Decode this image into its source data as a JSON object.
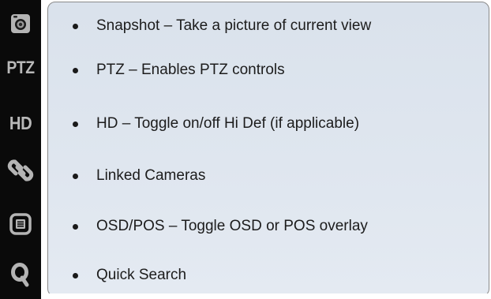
{
  "toolbar": {
    "ptz_label": "PTZ",
    "hd_label": "HD"
  },
  "items": [
    {
      "label": "Snapshot – Take a picture of current view",
      "icon": "camera-icon"
    },
    {
      "label": "PTZ – Enables PTZ controls",
      "icon": "ptz-icon"
    },
    {
      "label": "HD – Toggle on/off Hi Def (if applicable)",
      "icon": "hd-icon"
    },
    {
      "label": "Linked Cameras",
      "icon": "link-icon"
    },
    {
      "label": "OSD/POS – Toggle OSD or POS overlay",
      "icon": "osd-pos-icon"
    },
    {
      "label": "Quick Search",
      "icon": "search-icon"
    }
  ],
  "colors": {
    "toolbar_bg": "#0a0a0a",
    "icon": "#b6b6b6",
    "panel_bg": "#dfe6ef",
    "text": "#1c1c1c"
  }
}
